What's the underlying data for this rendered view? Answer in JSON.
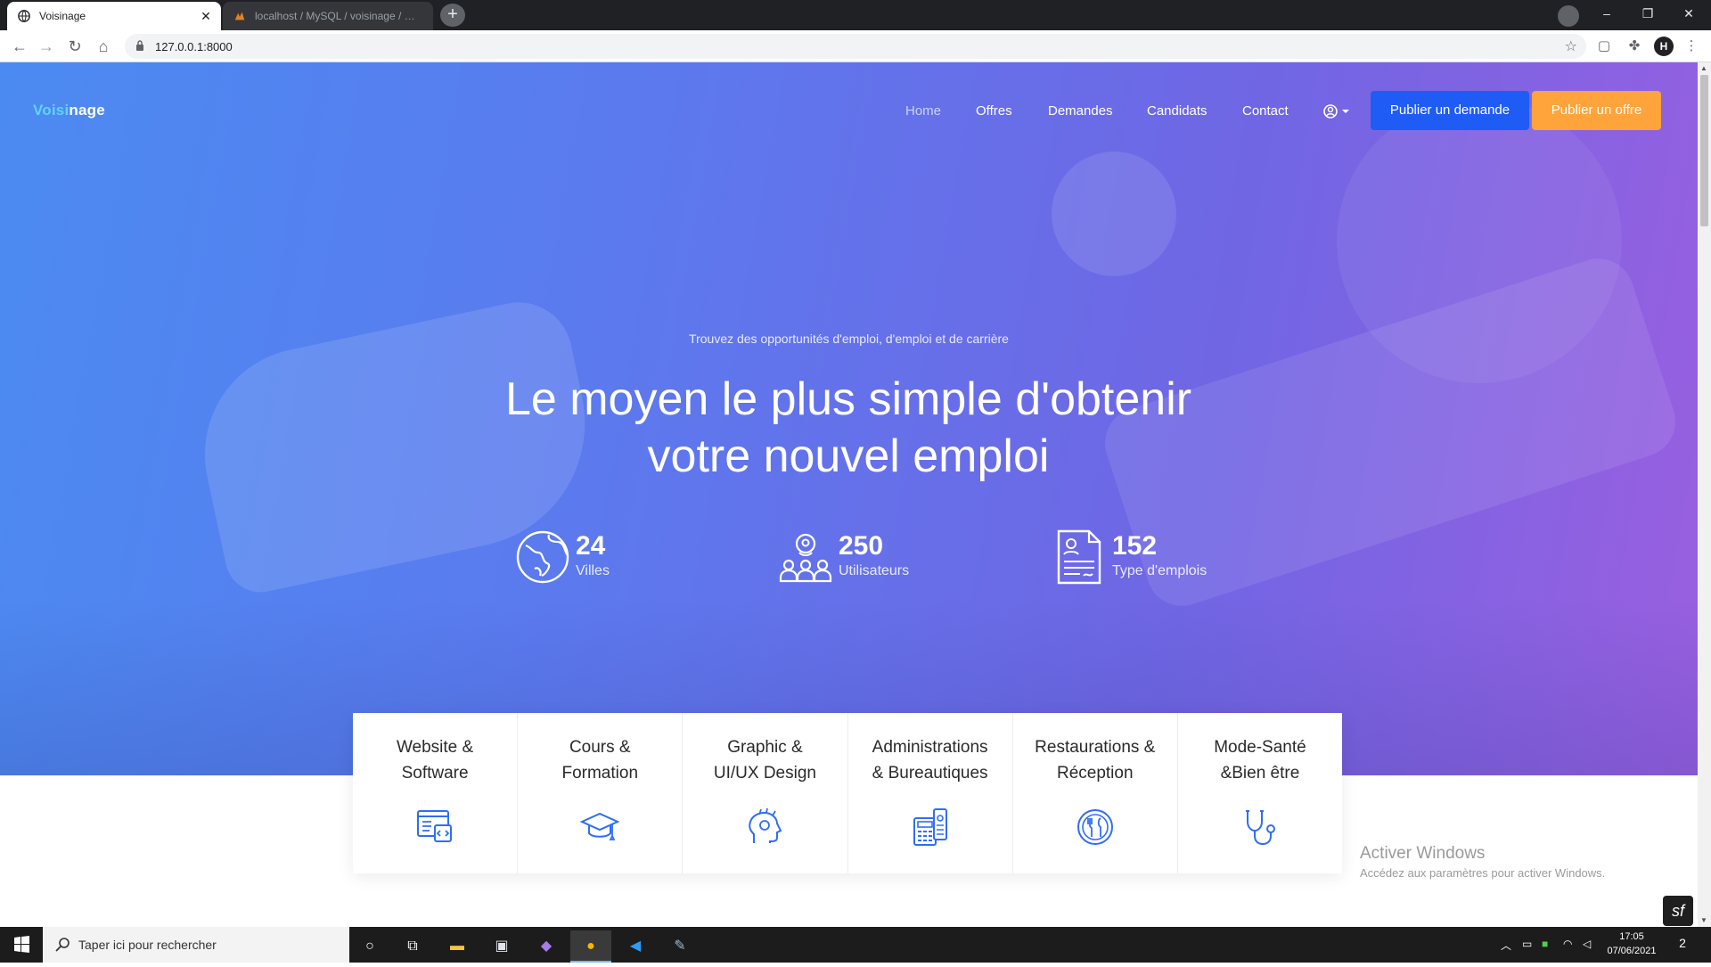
{
  "browser": {
    "tabs": [
      {
        "title": "Voisinage",
        "active": true
      },
      {
        "title": "localhost / MySQL / voisinage / …",
        "active": false
      }
    ],
    "new_tab_label": "+",
    "url": "127.0.0.1:8000",
    "window_controls": {
      "minimize": "–",
      "restore": "❐",
      "close": "✕"
    },
    "profile_initial": "H"
  },
  "site": {
    "brand_part1": "Voisi",
    "brand_part2": "nage",
    "nav": [
      {
        "label": "Home",
        "active": true
      },
      {
        "label": "Offres",
        "active": false
      },
      {
        "label": "Demandes",
        "active": false
      },
      {
        "label": "Candidats",
        "active": false
      },
      {
        "label": "Contact",
        "active": false
      }
    ],
    "btn_demande": "Publier un demande",
    "btn_offre": "Publier un offre",
    "colors": {
      "primary": "#1f5cf5",
      "accent": "#ffa43a",
      "gradient_start": "#4b8bf1",
      "gradient_end": "#9a5fe0"
    }
  },
  "hero": {
    "subtitle": "Trouvez des opportunités d'emploi, d'emploi et de carrière",
    "headline_line1": "Le moyen le plus simple d'obtenir",
    "headline_line2": "votre nouvel emploi",
    "stats": [
      {
        "icon": "globe-icon",
        "number": "24",
        "label": "Villes"
      },
      {
        "icon": "users-location-icon",
        "number": "250",
        "label": "Utilisateurs"
      },
      {
        "icon": "resume-icon",
        "number": "152",
        "label": "Type d'emplois"
      }
    ]
  },
  "categories": [
    {
      "label": "Website &\nSoftware",
      "icon": "web-code-icon"
    },
    {
      "label": "Cours &\nFormation",
      "icon": "graduation-cap-icon"
    },
    {
      "label": "Graphic &\nUI/UX Design",
      "icon": "creative-head-icon"
    },
    {
      "label": "Administrations\n& Bureautiques",
      "icon": "calculator-icon"
    },
    {
      "label": "Restaurations &\nRéception",
      "icon": "cutlery-icon"
    },
    {
      "label": "Mode-Santé\n&Bien être",
      "icon": "stethoscope-icon"
    }
  ],
  "watermark": {
    "title": "Activer Windows",
    "text": "Accédez aux paramètres pour activer Windows."
  },
  "taskbar": {
    "search_placeholder": "Taper ici pour rechercher",
    "time": "17:05",
    "date": "07/06/2021",
    "notifications": "2"
  }
}
